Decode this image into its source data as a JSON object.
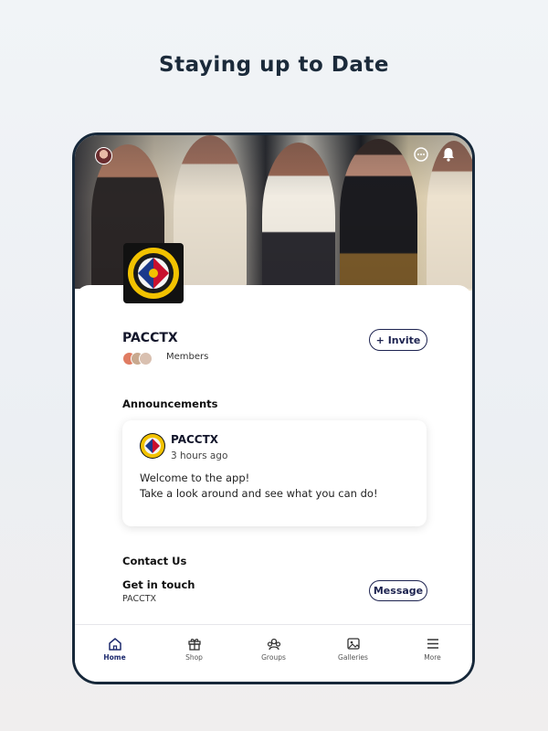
{
  "heading": "Staying up to Date",
  "group": {
    "name": "PACCTX",
    "members_label": "Members",
    "invite_label": "+ Invite"
  },
  "announcements": {
    "title": "Announcements",
    "card": {
      "author": "PACCTX",
      "time": "3 hours ago",
      "line1": "Welcome to the app!",
      "line2": "Take a look around and see what you can do!"
    }
  },
  "contact": {
    "title": "Contact Us",
    "subtitle": "Get in touch",
    "name": "PACCTX",
    "message_label": "Message"
  },
  "tabs": [
    {
      "label": "Home",
      "icon": "home-icon",
      "active": true
    },
    {
      "label": "Shop",
      "icon": "gift-icon",
      "active": false
    },
    {
      "label": "Groups",
      "icon": "groups-icon",
      "active": false
    },
    {
      "label": "Galleries",
      "icon": "image-icon",
      "active": false
    },
    {
      "label": "More",
      "icon": "menu-icon",
      "active": false
    }
  ],
  "colors": {
    "accent": "#1d2350",
    "active_tab": "#1d2a6e",
    "frame": "#17283a"
  }
}
